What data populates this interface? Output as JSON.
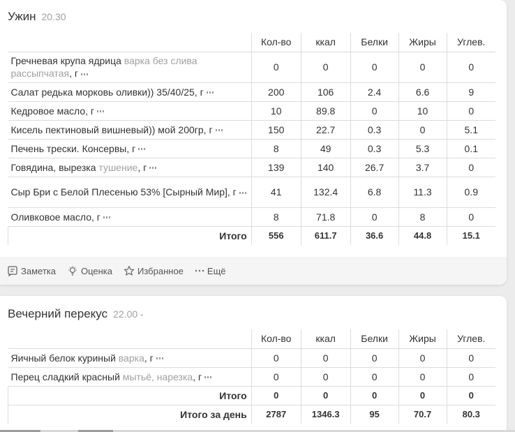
{
  "dinner": {
    "title": "Ужин",
    "time": "20.30",
    "headers": [
      "Кол-во",
      "ккал",
      "Белки",
      "Жиры",
      "Углев."
    ],
    "rows": [
      {
        "name": "Гречневая крупа ядрица",
        "note": "варка без слива рассыпчатая",
        "unit": ", г",
        "qty": "0",
        "kcal": "0",
        "protein": "0",
        "fat": "0",
        "carbs": "0"
      },
      {
        "name": "Салат редька морковь оливки)) 35/40/25",
        "note": "",
        "unit": ", г",
        "qty": "200",
        "kcal": "106",
        "protein": "2.4",
        "fat": "6.6",
        "carbs": "9"
      },
      {
        "name": "Кедровое масло",
        "note": "",
        "unit": ", г",
        "qty": "10",
        "kcal": "89.8",
        "protein": "0",
        "fat": "10",
        "carbs": "0"
      },
      {
        "name": "Кисель пектиновый вишневый)) мой 200гр",
        "note": "",
        "unit": ", г",
        "qty": "150",
        "kcal": "22.7",
        "protein": "0.3",
        "fat": "0",
        "carbs": "5.1"
      },
      {
        "name": "Печень трески. Консервы",
        "note": "",
        "unit": ", г",
        "qty": "8",
        "kcal": "49",
        "protein": "0.3",
        "fat": "5.3",
        "carbs": "0.1"
      },
      {
        "name": "Говядина, вырезка",
        "note": "тушение",
        "unit": ", г",
        "qty": "139",
        "kcal": "140",
        "protein": "26.7",
        "fat": "3.7",
        "carbs": "0"
      },
      {
        "name": "Сыр Бри с Белой Плесенью 53% [Сырный Мир]",
        "note": "",
        "unit": ", г",
        "qty": "41",
        "kcal": "132.4",
        "protein": "6.8",
        "fat": "11.3",
        "carbs": "0.9"
      },
      {
        "name": "Оливковое масло",
        "note": "",
        "unit": ", г",
        "qty": "8",
        "kcal": "71.8",
        "protein": "0",
        "fat": "8",
        "carbs": "0"
      }
    ],
    "total": {
      "label": "Итого",
      "qty": "556",
      "kcal": "611.7",
      "protein": "36.6",
      "fat": "44.8",
      "carbs": "15.1"
    },
    "footer": {
      "note": "Заметка",
      "rating": "Оценка",
      "favorite": "Избранное",
      "more": "Ещё"
    }
  },
  "snack": {
    "title": "Вечерний перекус",
    "time": "22.00 -",
    "headers": [
      "Кол-во",
      "ккал",
      "Белки",
      "Жиры",
      "Углев."
    ],
    "rows": [
      {
        "name": "Яичный белок куриный",
        "note": "варка",
        "unit": ", г",
        "qty": "0",
        "kcal": "0",
        "protein": "0",
        "fat": "0",
        "carbs": "0"
      },
      {
        "name": "Перец сладкий красный",
        "note": "мытьё, нарезка",
        "unit": ", г",
        "qty": "0",
        "kcal": "0",
        "protein": "0",
        "fat": "0",
        "carbs": "0"
      }
    ],
    "total": {
      "label": "Итого",
      "qty": "0",
      "kcal": "0",
      "protein": "0",
      "fat": "0",
      "carbs": "0"
    },
    "day_total": {
      "label": "Итого за день",
      "qty": "2787",
      "kcal": "1346.3",
      "protein": "95",
      "fat": "70.7",
      "carbs": "80.3"
    }
  },
  "colors": {
    "card": "#ffffff",
    "background": "#ececec",
    "muted": "#a0a0a0",
    "border": "#dcdcdc"
  },
  "icons": [
    "note-icon",
    "lightbulb-icon",
    "star-icon",
    "more-dots-icon"
  ]
}
